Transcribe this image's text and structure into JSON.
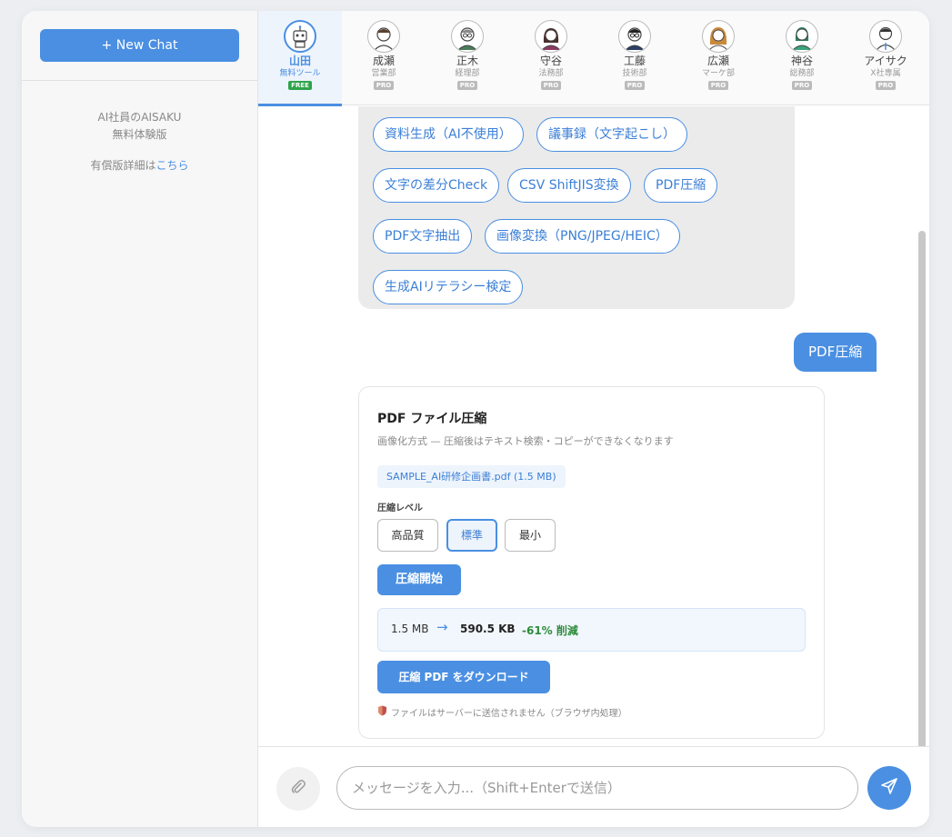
{
  "sidebar": {
    "new_chat": "+ New Chat",
    "product_line1": "AI社員のAISAKU",
    "product_line2": "無料体験版",
    "paid_prefix": "有償版詳細は",
    "paid_link": "こちら"
  },
  "tabs": [
    {
      "name": "山田",
      "dept": "無料ツール",
      "badge": "FREE",
      "active": true,
      "avatar": "robot-avatar-icon"
    },
    {
      "name": "成瀬",
      "dept": "営業部",
      "badge": "PRO",
      "active": false,
      "avatar": "person-avatar-icon"
    },
    {
      "name": "正木",
      "dept": "経理部",
      "badge": "PRO",
      "active": false,
      "avatar": "person-avatar-icon"
    },
    {
      "name": "守谷",
      "dept": "法務部",
      "badge": "PRO",
      "active": false,
      "avatar": "person-avatar-icon"
    },
    {
      "name": "工藤",
      "dept": "技術部",
      "badge": "PRO",
      "active": false,
      "avatar": "person-avatar-icon"
    },
    {
      "name": "広瀬",
      "dept": "マーケ部",
      "badge": "PRO",
      "active": false,
      "avatar": "person-avatar-icon"
    },
    {
      "name": "神谷",
      "dept": "総務部",
      "badge": "PRO",
      "active": false,
      "avatar": "person-avatar-icon"
    },
    {
      "name": "アイサク",
      "dept": "X社専属",
      "badge": "PRO",
      "active": false,
      "avatar": "person-avatar-icon"
    }
  ],
  "tools": [
    "資料生成（AI不使用）",
    "議事録（文字起こし）",
    "文字の差分Check",
    "CSV ShiftJIS変換",
    "PDF圧縮",
    "PDF文字抽出",
    "画像変換（PNG/JPEG/HEIC）",
    "生成AIリテラシー検定"
  ],
  "user_message": "PDF圧縮",
  "card": {
    "title": "PDF ファイル圧縮",
    "subtitle": "画像化方式 — 圧縮後はテキスト検索・コピーができなくなります",
    "file": "SAMPLE_AI研修企画書.pdf (1.5 MB)",
    "level_label": "圧縮レベル",
    "levels": [
      "高品質",
      "標準",
      "最小"
    ],
    "selected_level": "標準",
    "start_button": "圧縮開始",
    "size_before": "1.5 MB",
    "arrow": "→",
    "size_after": "590.5 KB",
    "reduction": "-61% 削減",
    "download_button": "圧縮 PDF をダウンロード",
    "notice": "ファイルはサーバーに送信されません（ブラウザ内処理）"
  },
  "composer": {
    "placeholder": "メッセージを入力...（Shift+Enterで送信）"
  },
  "colors": {
    "accent": "#4a8fe2",
    "free_badge": "#2ea34a",
    "reduction_text": "#2e8b3a"
  }
}
